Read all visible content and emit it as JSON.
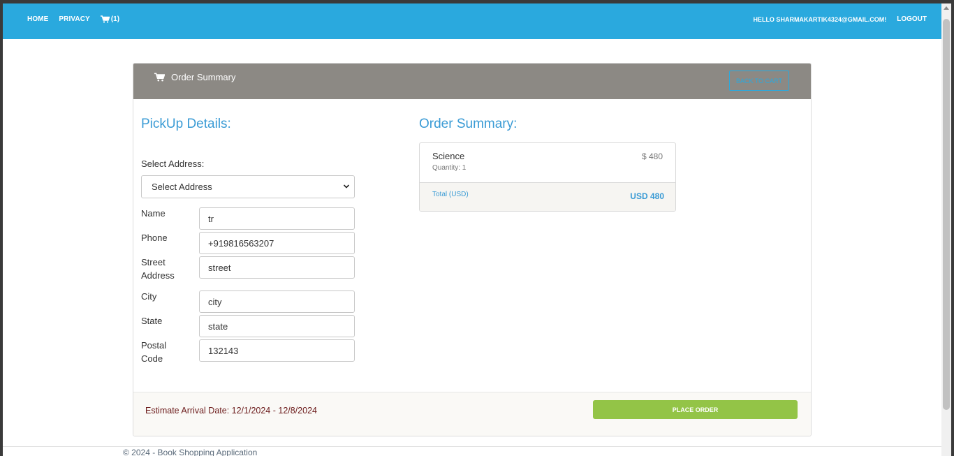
{
  "navbar": {
    "links": [
      "Home",
      "Privacy"
    ],
    "cart_count": "(1)",
    "greeting": "Hello sharmakartik4324@gmail.com!",
    "logout": "Logout",
    "bg_color": "#2aa9de"
  },
  "card": {
    "header_title": "Order Summary",
    "back_button": "Back to Cart",
    "header_bg": "#8c8984"
  },
  "pickup": {
    "title": "PickUp Details:",
    "select_label": "Select Address:",
    "select_value": "Select Address",
    "fields": [
      {
        "label": "Name",
        "value": "tr"
      },
      {
        "label": "Phone",
        "value": "+919816563207"
      },
      {
        "label": "Street Address",
        "value": "street"
      },
      {
        "label": "City",
        "value": "city"
      },
      {
        "label": "State",
        "value": "state"
      },
      {
        "label": "Postal Code",
        "value": "132143"
      }
    ]
  },
  "order": {
    "title": "Order Summary:",
    "items": [
      {
        "name": "Science",
        "quantity": "Quantity: 1",
        "price": "$ 480"
      }
    ],
    "total_label": "Total (USD)",
    "total_value": "USD 480"
  },
  "footer": {
    "estimate": "Estimate Arrival Date: 12/1/2024 - 12/8/2024",
    "place_order": "Place Order",
    "copyright": "© 2024 - Book Shopping Application"
  },
  "icons": {
    "cart": "cart-icon",
    "select_arrow": "chevron-down-icon"
  }
}
